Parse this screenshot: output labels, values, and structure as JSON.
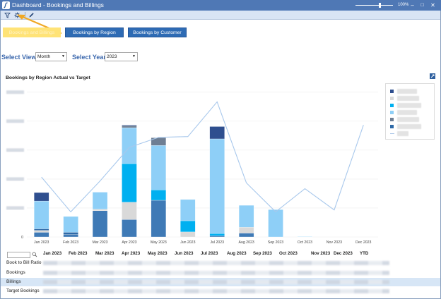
{
  "window": {
    "title": "Dashboard - Bookings and Billings",
    "zoom_label": "100%",
    "minimize": "–",
    "maximize": "□",
    "close": "✕"
  },
  "toolbar": {
    "icons": [
      "filter-icon",
      "settings-icon",
      "edit-icon"
    ]
  },
  "tabs": [
    {
      "label": "Bookings and Billings",
      "active": true
    },
    {
      "label": "Bookings by Region",
      "active": false
    },
    {
      "label": "Bookings by Customer",
      "active": false
    }
  ],
  "filters": {
    "view_label": "Select View:",
    "view_value": "Month",
    "year_label": "Select Year:",
    "year_value": "2023"
  },
  "chart_title": "Bookings by Region Actual vs Target",
  "chart_data": {
    "type": "bar",
    "title": "Bookings by Region Actual vs Target",
    "categories": [
      "Jan 2023",
      "Feb 2023",
      "Mar 2023",
      "Apr 2023",
      "May 2023",
      "Jun 2023",
      "Jul 2023",
      "Aug 2023",
      "Sep 2023",
      "Oct 2023",
      "Nov 2023",
      "Dec 2023"
    ],
    "stacked": true,
    "series": [
      {
        "color": "#3f7ab6",
        "values": [
          12,
          6,
          68,
          45,
          95,
          0,
          3,
          10,
          0,
          0,
          0,
          0
        ]
      },
      {
        "color": "#d9d9d9",
        "values": [
          5,
          0,
          4,
          45,
          0,
          13,
          0,
          15,
          0,
          0,
          0,
          0
        ]
      },
      {
        "color": "#2e6aa8",
        "values": [
          4,
          6,
          0,
          0,
          0,
          0,
          0,
          0,
          0,
          0,
          0,
          0
        ]
      },
      {
        "color": "#00b0f0",
        "values": [
          0,
          0,
          0,
          100,
          27,
          29,
          6,
          0,
          0,
          0,
          0,
          0
        ]
      },
      {
        "color": "#8ecff7",
        "values": [
          72,
          41,
          44,
          93,
          115,
          55,
          245,
          57,
          71,
          1,
          0,
          0
        ]
      },
      {
        "color": "#6e7e93",
        "values": [
          0,
          0,
          0,
          5,
          20,
          0,
          0,
          0,
          0,
          0,
          0,
          0
        ]
      },
      {
        "color": "#2f4f8f",
        "values": [
          22,
          0,
          0,
          2,
          0,
          0,
          32,
          0,
          0,
          0,
          0,
          0
        ]
      }
    ],
    "target": {
      "color": "#a8c8ec",
      "values": [
        155,
        65,
        145,
        232,
        258,
        260,
        350,
        140,
        65,
        125,
        70,
        290
      ]
    },
    "ylim": [
      0,
      380
    ],
    "grid": true,
    "legend": "right"
  },
  "legend_colors": [
    "#2f4f8f",
    "#d9d9d9",
    "#00b0f0",
    "#8ecff7",
    "#6e7e93",
    "#2e6aa8"
  ],
  "grid": {
    "columns": [
      "Jan 2023",
      "Feb 2023",
      "Mar 2023",
      "Apr 2023",
      "May 2023",
      "Jun 2023",
      "Jul 2023",
      "Aug 2023",
      "Sep 2023",
      "Oct 2023",
      "Nov 2023",
      "Dec 2023",
      "YTD"
    ],
    "rows": [
      "Book to Bill Ratio",
      "Bookings",
      "Billings",
      "Target Bookings"
    ]
  }
}
